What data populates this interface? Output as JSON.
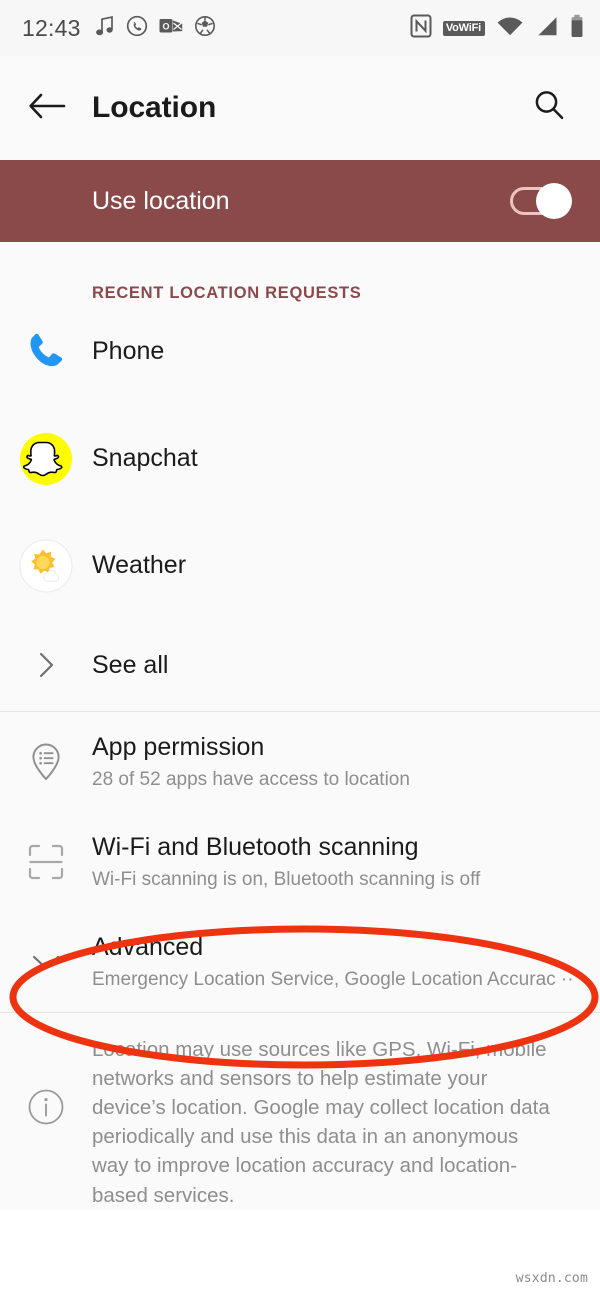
{
  "status_bar": {
    "clock": "12:43",
    "left_icons": [
      "music-note-icon",
      "whatsapp-icon",
      "outlook-icon",
      "soccer-ball-icon"
    ],
    "right_icons": [
      "nfc-icon",
      "vowifi-badge",
      "wifi-icon",
      "cellular-signal-icon",
      "battery-icon"
    ],
    "vowifi_label": "VoWiFi"
  },
  "header": {
    "back_icon": "back-arrow-icon",
    "title": "Location",
    "search_icon": "search-icon"
  },
  "use_location": {
    "label": "Use location",
    "toggle_state": "on",
    "bar_color": "#8b4a4a"
  },
  "recent_requests": {
    "section_label": "RECENT LOCATION REQUESTS",
    "apps": [
      {
        "name": "Phone",
        "icon": "phone-handset-icon"
      },
      {
        "name": "Snapchat",
        "icon": "snapchat-ghost-icon"
      },
      {
        "name": "Weather",
        "icon": "weather-sun-cloud-icon"
      }
    ],
    "see_all": {
      "label": "See all",
      "icon": "chevron-right-icon"
    }
  },
  "settings": [
    {
      "title": "App permission",
      "subtitle": "28 of 52 apps have access to location",
      "icon": "location-pin-list-icon"
    },
    {
      "title": "Wi-Fi and Bluetooth scanning",
      "subtitle": "Wi-Fi scanning is on, Bluetooth scanning is off",
      "icon": "scanner-frame-icon"
    },
    {
      "title": "Advanced",
      "subtitle": "Emergency Location Service, Google Location Accurac ··",
      "icon": "chevron-down-icon"
    }
  ],
  "footer": {
    "icon": "info-circle-icon",
    "text": "Location may use sources like GPS, Wi-Fi, mobile networks and sensors to help estimate your device’s location. Google may collect location data periodically and use this data in an anonymous way to improve location accuracy and location-based services."
  },
  "annotation": {
    "shape": "ellipse",
    "color": "#ee3311",
    "target": "Advanced"
  },
  "watermark": "wsxdn.com"
}
